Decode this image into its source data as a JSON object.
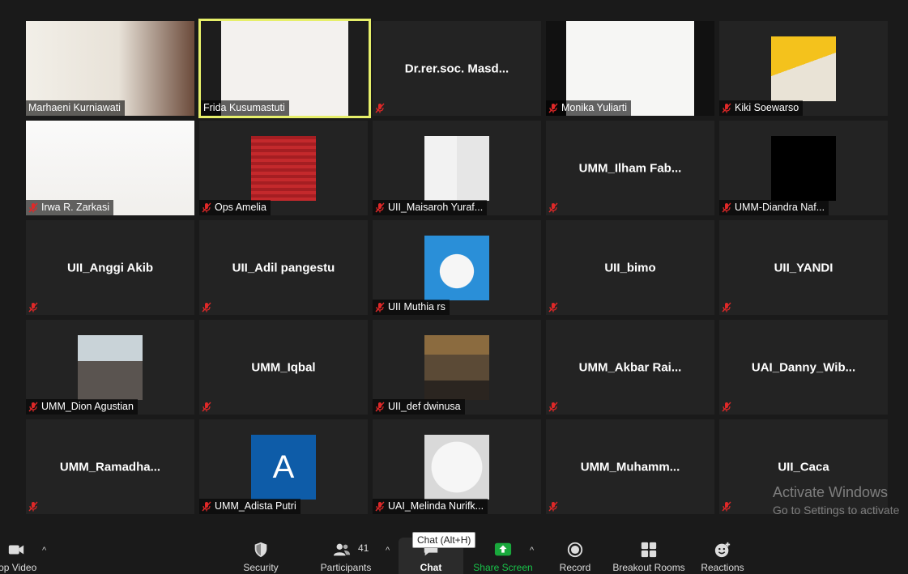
{
  "participants": [
    {
      "name": "Marhaeni Kurniawati",
      "type": "video",
      "muted": false
    },
    {
      "name": "Frida Kusumastuti",
      "type": "video",
      "muted": false,
      "active": true
    },
    {
      "name": "Dr.rer.soc.  Masd...",
      "type": "text",
      "muted": true
    },
    {
      "name": "Monika Yuliarti",
      "type": "video",
      "muted": true
    },
    {
      "name": "Kiki Soewarso",
      "type": "avatar",
      "muted": true
    },
    {
      "name": "Irwa R. Zarkasi",
      "type": "video",
      "muted": true
    },
    {
      "name": "Ops Amelia",
      "type": "avatar",
      "muted": true
    },
    {
      "name": "UII_Maisaroh Yuraf...",
      "type": "avatar",
      "muted": true
    },
    {
      "name": "UMM_Ilham  Fab...",
      "type": "text",
      "muted": true
    },
    {
      "name": "UMM-Diandra Naf...",
      "type": "avatar",
      "muted": true
    },
    {
      "name": "UII_Anggi Akib",
      "type": "text",
      "muted": true
    },
    {
      "name": "UII_Adil pangestu",
      "type": "text",
      "muted": true
    },
    {
      "name": "UII Muthia rs",
      "type": "avatar",
      "muted": true
    },
    {
      "name": "UII_bimo",
      "type": "text",
      "muted": true
    },
    {
      "name": "UII_YANDI",
      "type": "text",
      "muted": true
    },
    {
      "name": "UMM_Dion Agustian",
      "type": "avatar",
      "muted": true
    },
    {
      "name": "UMM_Iqbal",
      "type": "text",
      "muted": true
    },
    {
      "name": "UII_def dwinusa",
      "type": "avatar",
      "muted": true
    },
    {
      "name": "UMM_Akbar  Rai...",
      "type": "text",
      "muted": true
    },
    {
      "name": "UAI_Danny_Wib...",
      "type": "text",
      "muted": true
    },
    {
      "name": "UMM_Ramadha...",
      "type": "text",
      "muted": true
    },
    {
      "name": "UMM_Adista Putri",
      "type": "letter",
      "letter": "A",
      "muted": true
    },
    {
      "name": "UAI_Melinda Nurifk...",
      "type": "avatar",
      "muted": true
    },
    {
      "name": "UMM_Muhamm...",
      "type": "text",
      "muted": true
    },
    {
      "name": "UII_Caca",
      "type": "text",
      "muted": true
    }
  ],
  "watermark": {
    "line1": "Activate Windows",
    "line2": "Go to Settings to activate"
  },
  "toolbar": {
    "stop_video": "top Video",
    "security": "Security",
    "participants": "Participants",
    "participants_count": "41",
    "chat": "Chat",
    "chat_tooltip": "Chat (Alt+H)",
    "share_screen": "Share Screen",
    "record": "Record",
    "breakout_rooms": "Breakout Rooms",
    "reactions": "Reactions"
  },
  "colors": {
    "active_border": "#e6ef6a",
    "share_green": "#19a83c",
    "letter_avatar": "#0e5ca8"
  }
}
